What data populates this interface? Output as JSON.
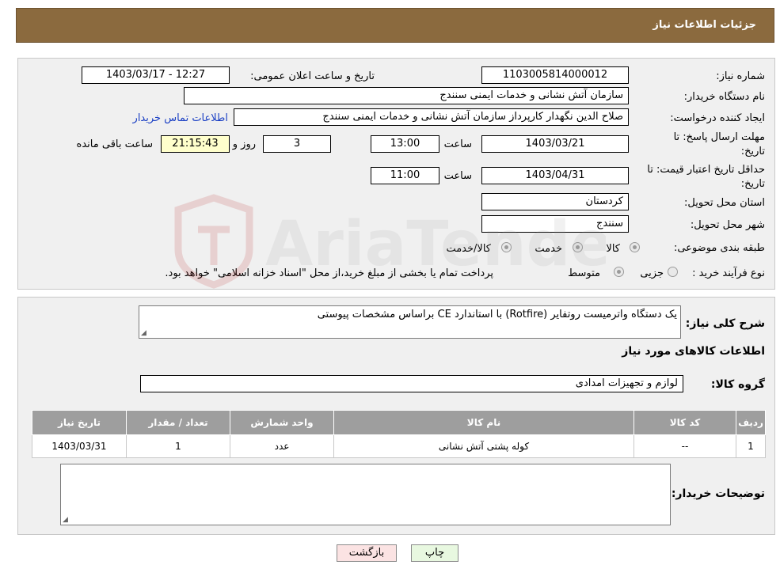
{
  "header": {
    "title": "جزئیات اطلاعات نیاز"
  },
  "form": {
    "need_number_label": "شماره نیاز:",
    "need_number": "1103005814000012",
    "announce_label": "تاریخ و ساعت اعلان عمومی:",
    "announce_value": "1403/03/17 - 12:27",
    "buyer_org_label": "نام دستگاه خریدار:",
    "buyer_org": "سازمان آتش نشانی و خدمات ایمنی سنندج",
    "creator_label": "ایجاد کننده درخواست:",
    "creator": "صلاح الدین نگهدار کارپرداز سازمان آتش نشانی و خدمات ایمنی سنندج",
    "contact_link": "اطلاعات تماس خریدار",
    "deadline_label_1": "مهلت ارسال پاسخ: تا",
    "deadline_label_2": "تاریخ:",
    "deadline_date": "1403/03/21",
    "hour_label": "ساعت",
    "deadline_time": "13:00",
    "days_value": "3",
    "days_label": "روز و",
    "remaining_time": "21:15:43",
    "remaining_label": "ساعت باقی مانده",
    "validity_label_1": "حداقل تاریخ اعتبار قیمت: تا",
    "validity_label_2": "تاریخ:",
    "validity_date": "1403/04/31",
    "validity_hour_label": "ساعت",
    "validity_time": "11:00",
    "province_label": "استان محل تحویل:",
    "province": "کردستان",
    "city_label": "شهر محل تحویل:",
    "city": "سنندج",
    "category_label": "طبقه بندی موضوعی:",
    "category_options": [
      "کالا",
      "خدمت",
      "کالا/خدمت"
    ],
    "process_label": "نوع فرآیند خرید :",
    "process_options": [
      "جزیی",
      "متوسط"
    ],
    "process_note": "پرداخت تمام یا بخشی از مبلغ خرید،از محل \"اسناد خزانه اسلامی\" خواهد بود."
  },
  "details": {
    "summary_label": "شرح کلی نیاز:",
    "summary": "یک دستگاه واترمیست روتفایر (Rotfire) با استاندارد CE براساس مشخصات پیوستی",
    "goods_info_title": "اطلاعات کالاهای مورد نیاز",
    "group_label": "گروه کالا:",
    "group_value": "لوازم و تجهیزات امدادی",
    "table": {
      "headers": [
        "ردیف",
        "کد کالا",
        "نام کالا",
        "واحد شمارش",
        "تعداد / مقدار",
        "تاریخ نیاز"
      ],
      "rows": [
        [
          "1",
          "--",
          "کوله پشتی آتش نشانی",
          "عدد",
          "1",
          "1403/03/31"
        ]
      ]
    },
    "buyer_notes_label": "توضیحات خریدار:"
  },
  "buttons": {
    "print": "چاپ",
    "back": "بازگشت"
  },
  "watermark_text": "AriaTender.neT",
  "colors": {
    "header_bg": "#8b6a3e",
    "table_header_bg": "#9e9e9e",
    "back_button_bg": "#fbe3e3",
    "print_button_bg": "#e8f8e0",
    "remaining_bg": "#ffffcc"
  }
}
